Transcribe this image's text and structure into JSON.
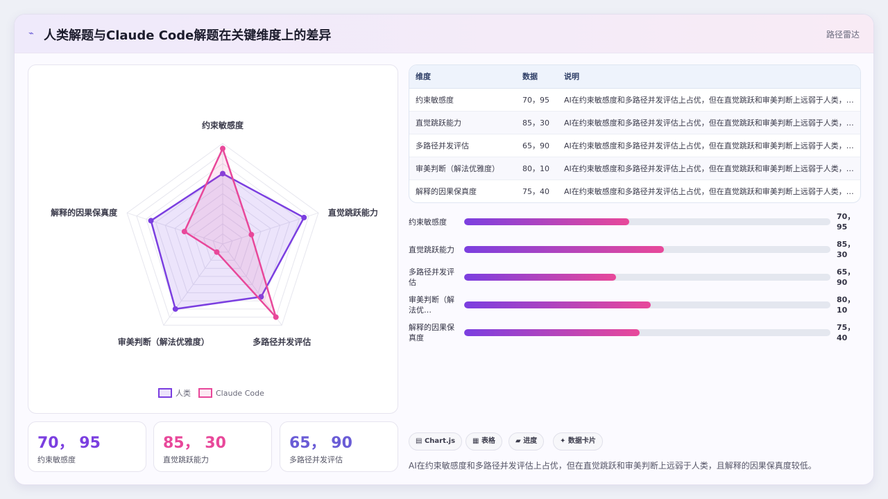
{
  "header": {
    "icon": "pulse-icon",
    "title": "人类解题与Claude Code解题在关键维度上的差异",
    "tag": "路径雷达"
  },
  "chart_data": {
    "type": "radar",
    "categories": [
      "约束敏感度",
      "直觉跳跃能力",
      "多路径并发评估",
      "审美判断（解法优雅度）",
      "解释的因果保真度"
    ],
    "series": [
      {
        "name": "人类",
        "values": [
          70,
          85,
          65,
          80,
          75
        ],
        "color": "#7b3fe0"
      },
      {
        "name": "Claude Code",
        "values": [
          95,
          30,
          90,
          10,
          40
        ],
        "color": "#e8489a"
      }
    ],
    "rlim": [
      0,
      100
    ],
    "grid": true,
    "legend": "bottom"
  },
  "stats": [
    {
      "value": "70， 95",
      "label": "约束敏感度",
      "color": "#7b3fe0"
    },
    {
      "value": "85， 30",
      "label": "直觉跳跃能力",
      "color": "#e8489a"
    },
    {
      "value": "65， 90",
      "label": "多路径并发评估",
      "color": "#6a5cd6"
    }
  ],
  "table": {
    "headers": [
      "维度",
      "数据",
      "说明"
    ],
    "rows": [
      [
        "约束敏感度",
        "70，95",
        "AI在约束敏感度和多路径并发评估上占优，但在直觉跳跃和审美判断上远弱于人类，且解释的因果保真度较低。"
      ],
      [
        "直觉跳跃能力",
        "85，30",
        "AI在约束敏感度和多路径并发评估上占优，但在直觉跳跃和审美判断上远弱于人类，且解释的因果保真度较低。"
      ],
      [
        "多路径并发评估",
        "65，90",
        "AI在约束敏感度和多路径并发评估上占优，但在直觉跳跃和审美判断上远弱于人类，且解释的因果保真度较低。"
      ],
      [
        "审美判断（解法优雅度）",
        "80，10",
        "AI在约束敏感度和多路径并发评估上占优，但在直觉跳跃和审美判断上远弱于人类，且解释的因果保真度较低。"
      ],
      [
        "解释的因果保真度",
        "75，40",
        "AI在约束敏感度和多路径并发评估上占优，但在直觉跳跃和审美判断上远弱于人类，且解释的因果保真度较低。"
      ]
    ]
  },
  "bars": [
    {
      "label": "约束敏感度",
      "value": "70，95",
      "progress": 0.45
    },
    {
      "label": "直觉跳跃能力",
      "value": "85，30",
      "progress": 0.545
    },
    {
      "label": "多路径并发评估",
      "value": "65，90",
      "progress": 0.415
    },
    {
      "label": "审美判断（解法优…",
      "value": "80，10",
      "progress": 0.51
    },
    {
      "label": "解释的因果保真度",
      "value": "75，40",
      "progress": 0.48
    }
  ],
  "tabs": [
    {
      "icon": "chart-icon",
      "glyph": "▤",
      "label": "Chart.js"
    },
    {
      "icon": "table-icon",
      "glyph": "▦",
      "label": "表格"
    },
    {
      "icon": "progress-icon",
      "glyph": "▰",
      "label": "进度"
    },
    {
      "icon": "sparkle-icon",
      "glyph": "✦",
      "label": "数据卡片"
    }
  ],
  "summary": "AI在约束敏感度和多路径并发评估上占优，但在直觉跳跃和审美判断上远弱于人类，且解释的因果保真度较低。"
}
